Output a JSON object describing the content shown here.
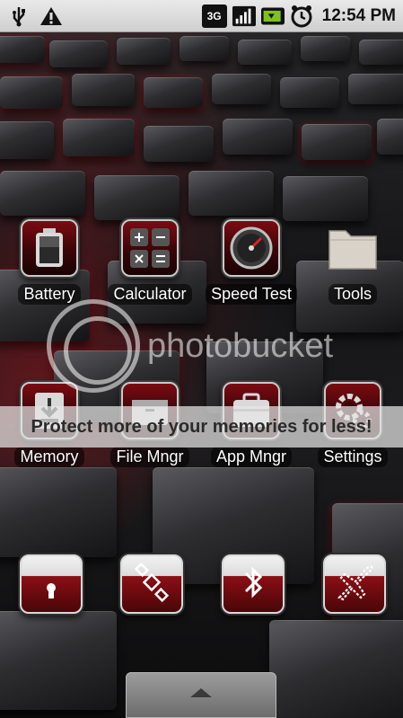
{
  "status_bar": {
    "icons_left": [
      "usb-icon",
      "warning-icon"
    ],
    "network_type": "3G",
    "icons_right": [
      "signal-icon",
      "battery-icon",
      "alarm-icon"
    ],
    "time": "12:54 PM"
  },
  "apps_row1": [
    {
      "label": "Battery",
      "icon": "battery-icon"
    },
    {
      "label": "Calculator",
      "icon": "calculator-icon"
    },
    {
      "label": "Speed Test",
      "icon": "speedometer-icon"
    },
    {
      "label": "Tools",
      "icon": "folder-icon"
    }
  ],
  "apps_row2": [
    {
      "label": "Memory",
      "icon": "memory-icon"
    },
    {
      "label": "File Mngr",
      "icon": "file-manager-icon"
    },
    {
      "label": "App Mngr",
      "icon": "app-manager-icon"
    },
    {
      "label": "Settings",
      "icon": "gear-icon"
    }
  ],
  "dock": [
    {
      "icon": "lock-toggle-icon"
    },
    {
      "icon": "gps-satellite-icon"
    },
    {
      "icon": "bluetooth-icon"
    },
    {
      "icon": "airplane-mode-icon"
    }
  ],
  "watermark": {
    "brand": "photobucket",
    "banner": "Protect more of your memories for less!"
  },
  "drawer": {
    "icon": "chevron-up-icon"
  },
  "colors": {
    "accent": "#8a0f15",
    "statusbar": "#d9d9d9"
  }
}
